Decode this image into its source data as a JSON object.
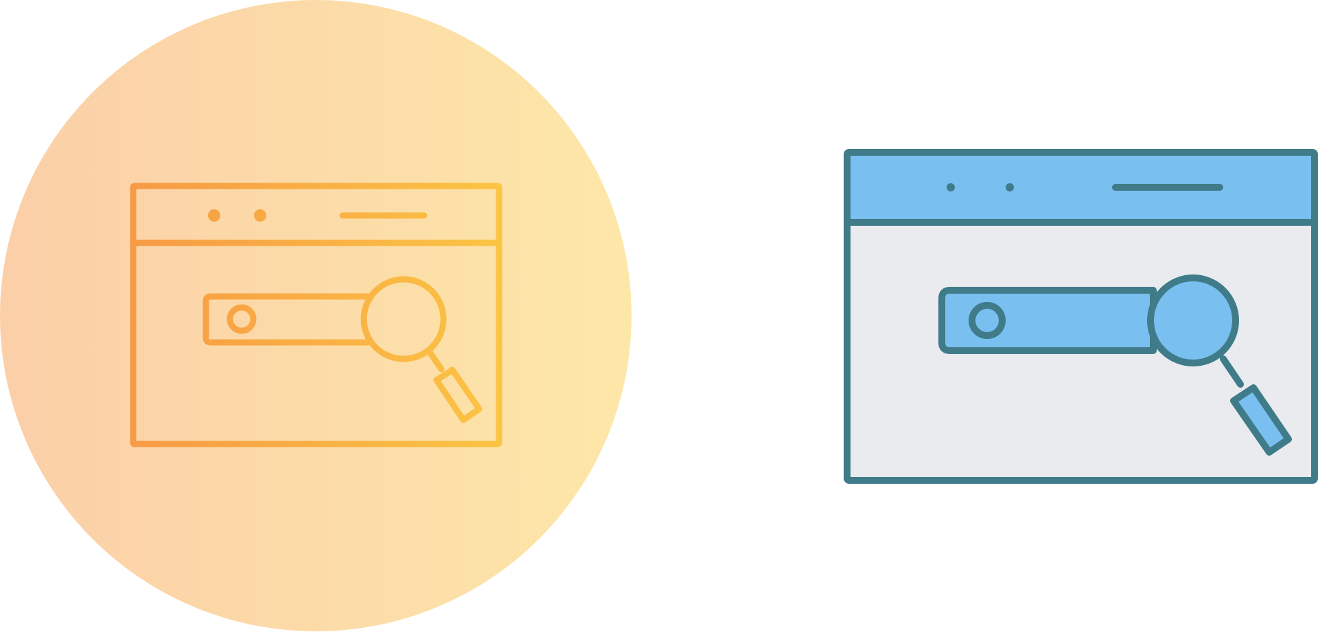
{
  "icons": [
    {
      "name": "browser-search-icon",
      "style": "gradient-line",
      "background": {
        "shape": "circle",
        "gradient": [
          "#fbcfa8",
          "#fde7a8"
        ]
      },
      "stroke_gradient": [
        "#f79a45",
        "#fbc443"
      ]
    },
    {
      "name": "browser-search-icon",
      "style": "filled-line",
      "stroke": "#3f7b89",
      "header_fill": "#79bff0",
      "body_fill": "#e9ebef",
      "search_fill": "#79bff0"
    }
  ]
}
